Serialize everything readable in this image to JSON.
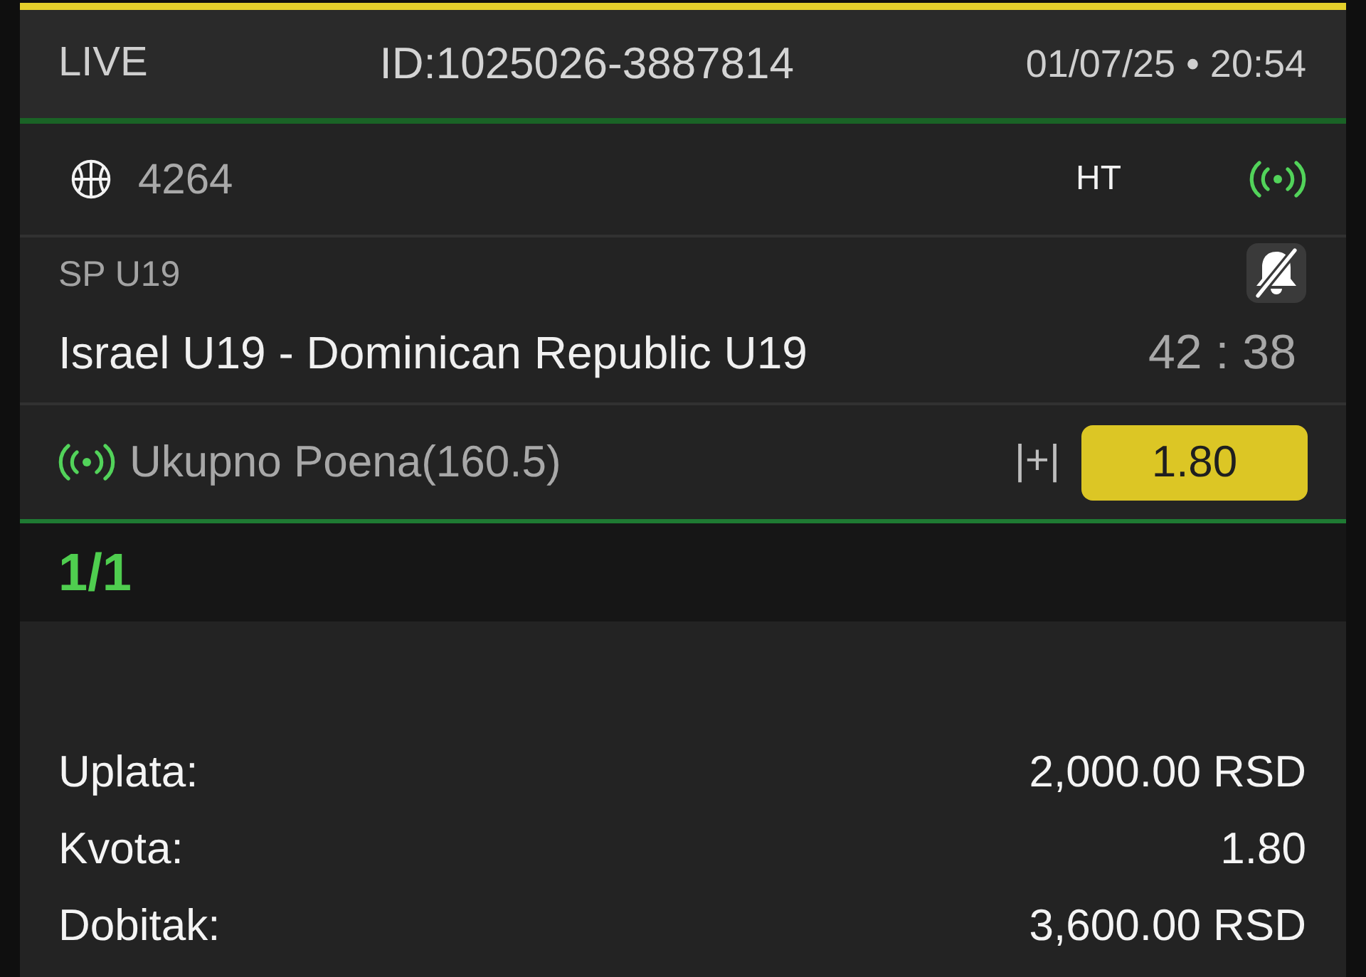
{
  "header": {
    "mode": "LIVE",
    "ticket_id": "ID:1025026-3887814",
    "datetime": "01/07/25 • 20:54"
  },
  "event": {
    "code": "4264",
    "period": "HT",
    "live": true
  },
  "league": {
    "name": "SP U19",
    "notifications_muted": true
  },
  "match": {
    "teams": "Israel U19 - Dominican Republic U19",
    "score": "42 : 38"
  },
  "selection": {
    "live": true,
    "market": "Ukupno Poena(160.5)",
    "marker": "|+|",
    "odds": "1.80"
  },
  "combination": "1/1",
  "summary": [
    {
      "label": "Uplata:",
      "value": "2,000.00 RSD"
    },
    {
      "label": "Kvota:",
      "value": "1.80"
    },
    {
      "label": "Dobitak:",
      "value": "3,600.00 RSD"
    }
  ]
}
